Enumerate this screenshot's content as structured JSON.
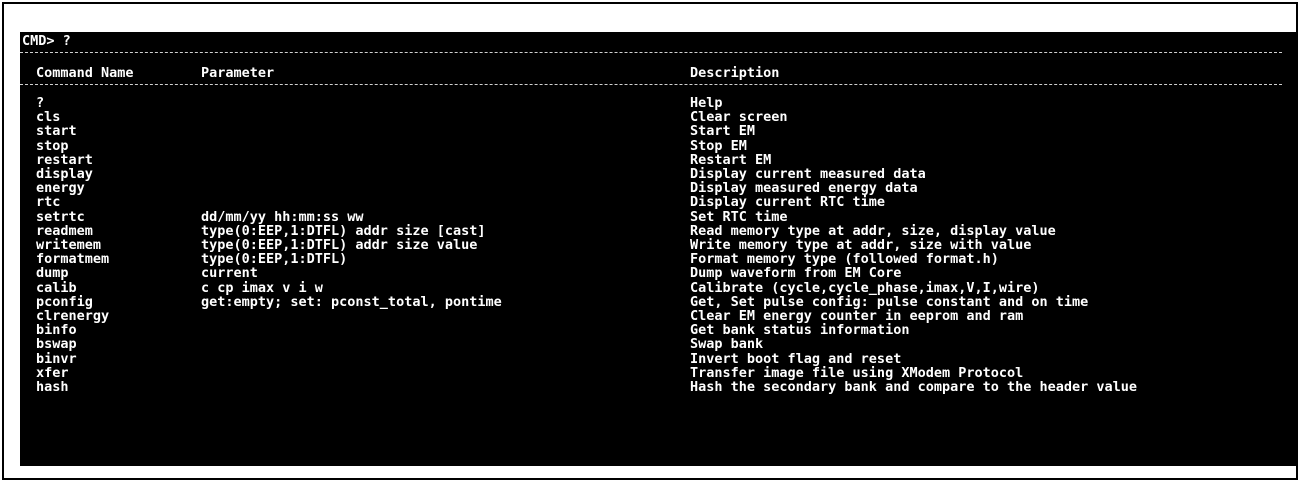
{
  "console": {
    "prompt": "CMD> ?",
    "headers": {
      "name": "Command Name",
      "param": "Parameter",
      "desc": "Description"
    },
    "rows": [
      {
        "name": "?",
        "param": "",
        "desc": "Help"
      },
      {
        "name": "cls",
        "param": "",
        "desc": "Clear screen"
      },
      {
        "name": "start",
        "param": "",
        "desc": "Start EM"
      },
      {
        "name": "stop",
        "param": "",
        "desc": "Stop EM"
      },
      {
        "name": "restart",
        "param": "",
        "desc": "Restart EM"
      },
      {
        "name": "display",
        "param": "",
        "desc": "Display current measured data"
      },
      {
        "name": "energy",
        "param": "",
        "desc": "Display measured energy data"
      },
      {
        "name": "rtc",
        "param": "",
        "desc": "Display current RTC time"
      },
      {
        "name": "setrtc",
        "param": "dd/mm/yy hh:mm:ss ww",
        "desc": "Set RTC time"
      },
      {
        "name": "readmem",
        "param": "type(0:EEP,1:DTFL) addr size [cast]",
        "desc": "Read memory type at addr, size, display value"
      },
      {
        "name": "writemem",
        "param": "type(0:EEP,1:DTFL) addr size value",
        "desc": "Write memory type at addr, size with value"
      },
      {
        "name": "formatmem",
        "param": "type(0:EEP,1:DTFL)",
        "desc": "Format memory type (followed format.h)"
      },
      {
        "name": "dump",
        "param": "current",
        "desc": "Dump waveform from EM Core"
      },
      {
        "name": "calib",
        "param": "c cp imax v i w",
        "desc": "Calibrate (cycle,cycle_phase,imax,V,I,wire)"
      },
      {
        "name": "pconfig",
        "param": "get:empty; set: pconst_total, pontime",
        "desc": "Get, Set pulse config: pulse constant and on time"
      },
      {
        "name": "clrenergy",
        "param": "",
        "desc": "Clear EM energy counter in eeprom and ram"
      },
      {
        "name": "binfo",
        "param": "",
        "desc": "Get bank status information"
      },
      {
        "name": "bswap",
        "param": "",
        "desc": "Swap bank"
      },
      {
        "name": "binvr",
        "param": "",
        "desc": "Invert boot flag and reset"
      },
      {
        "name": "xfer",
        "param": "",
        "desc": "Transfer image file using XModem Protocol"
      },
      {
        "name": "hash",
        "param": "",
        "desc": "Hash the secondary bank and compare to the header value"
      }
    ]
  }
}
